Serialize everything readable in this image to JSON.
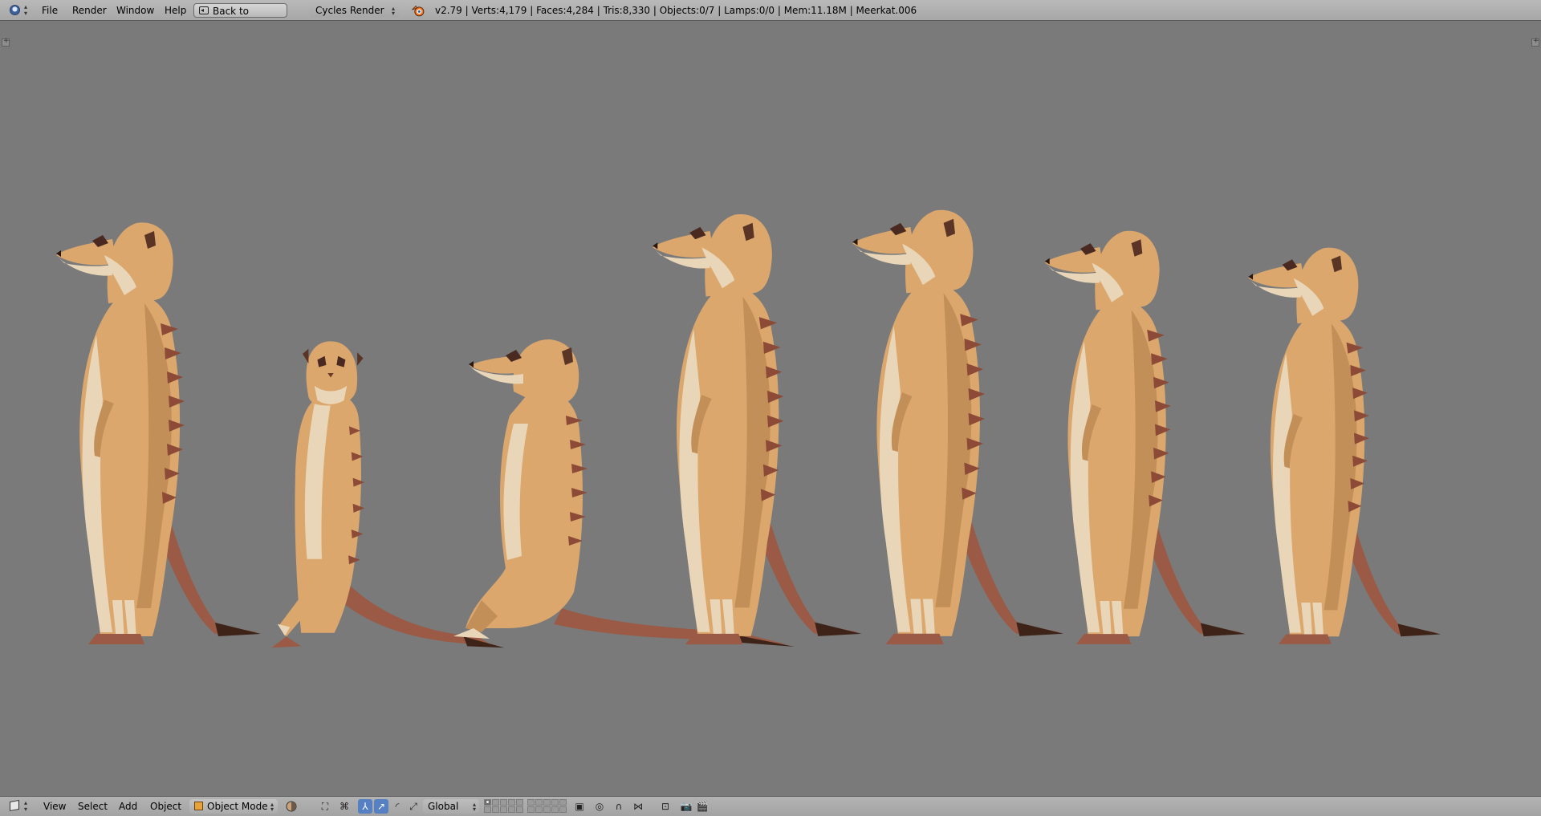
{
  "header": {
    "menus": [
      "File",
      "Render",
      "Window",
      "Help"
    ],
    "back_button": "Back to Previous",
    "render_engine": "Cycles Render",
    "stats": "v2.79 | Verts:4,179 | Faces:4,284 | Tris:8,330 | Objects:0/7 | Lamps:0/0 | Mem:11.18M | Meerkat.006"
  },
  "view_header": {
    "menus": [
      "View",
      "Select",
      "Add",
      "Object"
    ],
    "mode": "Object Mode",
    "orientation": "Global"
  },
  "viewport": {
    "background_color": "#7a7a7a",
    "object_count": 7
  },
  "colors": {
    "fur": "#dba76c",
    "fur_shadow": "#c38f58",
    "belly": "#e9d6b8",
    "stripes": "#8c4a37",
    "tail": "#9a5a45",
    "tail_tip": "#3e2418",
    "selection_active": "#5680c2"
  },
  "icons": {
    "editor_type": "info-icon",
    "view_editor_type": "3d-view-icon",
    "scene": "blender-logo-icon",
    "mode": "object-mode-cube-icon"
  }
}
